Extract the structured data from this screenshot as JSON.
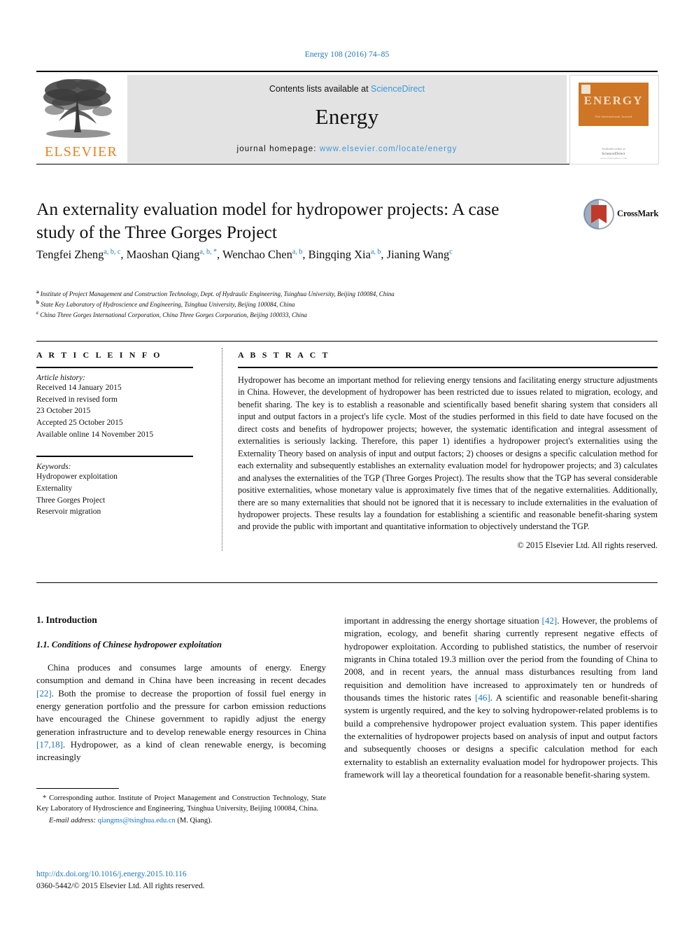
{
  "running_head": "Energy 108 (2016) 74–85",
  "masthead": {
    "contents_prefix": "Contents lists available at ",
    "contents_link": "ScienceDirect",
    "journal_title": "Energy",
    "homepage_prefix": "journal homepage: ",
    "homepage_url": "www.elsevier.com/locate/energy",
    "publisher_name": "ELSEVIER",
    "cover": {
      "title": "ENERGY",
      "subtitle": "The International Journal",
      "footer_1": "Available online at",
      "footer_2": "ScienceDirect",
      "footer_3": "www.sciencedirect.com"
    }
  },
  "article": {
    "title": "An externality evaluation model for hydropower projects: A case study of the Three Gorges Project",
    "crossmark_label": "CrossMark",
    "authors": [
      {
        "name": "Tengfei Zheng",
        "marks": "a, b, c",
        "sep": ", "
      },
      {
        "name": "Maoshan Qiang",
        "marks": "a, b, *",
        "sep": ", "
      },
      {
        "name": "Wenchao Chen",
        "marks": "a, b",
        "sep": ", "
      },
      {
        "name": "Bingqing Xia",
        "marks": "a, b",
        "sep": ", "
      },
      {
        "name": "Jianing Wang",
        "marks": "c",
        "sep": ""
      }
    ],
    "affiliations": [
      {
        "mark": "a",
        "text": "Institute of Project Management and Construction Technology, Dept. of Hydraulic Engineering, Tsinghua University, Beijing 100084, China"
      },
      {
        "mark": "b",
        "text": "State Key Laboratory of Hydroscience and Engineering, Tsinghua University, Beijing 100084, China"
      },
      {
        "mark": "c",
        "text": "China Three Gorges International Corporation, China Three Gorges Corporation, Beijing 100033, China"
      }
    ]
  },
  "article_info": {
    "heading": "A R T I C L E  I N F O",
    "history_label": "Article history:",
    "history": [
      "Received 14 January 2015",
      "Received in revised form",
      "23 October 2015",
      "Accepted 25 October 2015",
      "Available online 14 November 2015"
    ],
    "keywords_label": "Keywords:",
    "keywords": [
      "Hydropower exploitation",
      "Externality",
      "Three Gorges Project",
      "Reservoir migration"
    ]
  },
  "abstract": {
    "heading": "A B S T R A C T",
    "body": "Hydropower has become an important method for relieving energy tensions and facilitating energy structure adjustments in China. However, the development of hydropower has been restricted due to issues related to migration, ecology, and benefit sharing. The key is to establish a reasonable and scientifically based benefit sharing system that considers all input and output factors in a project's life cycle. Most of the studies performed in this field to date have focused on the direct costs and benefits of hydropower projects; however, the systematic identification and integral assessment of externalities is seriously lacking. Therefore, this paper 1) identifies a hydropower project's externalities using the Externality Theory based on analysis of input and output factors; 2) chooses or designs a specific calculation method for each externality and subsequently establishes an externality evaluation model for hydropower projects; and 3) calculates and analyses the externalities of the TGP (Three Gorges Project). The results show that the TGP has several considerable positive externalities, whose monetary value is approximately five times that of the negative externalities. Additionally, there are so many externalities that should not be ignored that it is necessary to include externalities in the evaluation of hydropower projects. These results lay a foundation for establishing a scientific and reasonable benefit-sharing system and provide the public with important and quantitative information to objectively understand the TGP.",
    "copyright": "© 2015 Elsevier Ltd. All rights reserved."
  },
  "body": {
    "section_heading": "1. Introduction",
    "subsection_heading": "1.1. Conditions of Chinese hydropower exploitation",
    "left_paragraph_parts": [
      "China produces and consumes large amounts of energy. Energy consumption and demand in China have been increasing in recent decades ",
      "[22]",
      ". Both the promise to decrease the proportion of fossil fuel energy in energy generation portfolio and the pressure for carbon emission reductions have encouraged the Chinese government to rapidly adjust the energy generation infrastructure and to develop renewable energy resources in China ",
      "[17,18]",
      ". Hydropower, as a kind of clean renewable energy, is becoming increasingly"
    ],
    "right_paragraph_parts": [
      "important in addressing the energy shortage situation ",
      "[42]",
      ". However, the problems of migration, ecology, and benefit sharing currently represent negative effects of hydropower exploitation. According to published statistics, the number of reservoir migrants in China totaled 19.3 million over the period from the founding of China to 2008, and in recent years, the annual mass disturbances resulting from land requisition and demolition have increased to approximately ten or hundreds of thousands times the historic rates ",
      "[46]",
      ". A scientific and reasonable benefit-sharing system is urgently required, and the key to solving hydropower-related problems is to build a comprehensive hydropower project evaluation system. This paper identifies the externalities of hydropower projects based on analysis of input and output factors and subsequently chooses or designs a specific calculation method for each externality to establish an externality evaluation model for hydropower projects. This framework will lay a theoretical foundation for a reasonable benefit-sharing system."
    ]
  },
  "footnote": {
    "corresponding": "* Corresponding author. Institute of Project Management and Construction Technology, State Key Laboratory of Hydroscience and Engineering, Tsinghua University, Beijing 100084, China.",
    "email_label": "E-mail address:",
    "email": "qiangms@tsinghua.edu.cn",
    "email_suffix": "(M. Qiang).",
    "doi": "http://dx.doi.org/10.1016/j.energy.2015.10.116",
    "issn": "0360-5442/© 2015 Elsevier Ltd. All rights reserved."
  },
  "colors": {
    "link": "#1b75bb",
    "elsevier_orange": "#f07f1a",
    "band_gray": "#e3e3e3"
  }
}
